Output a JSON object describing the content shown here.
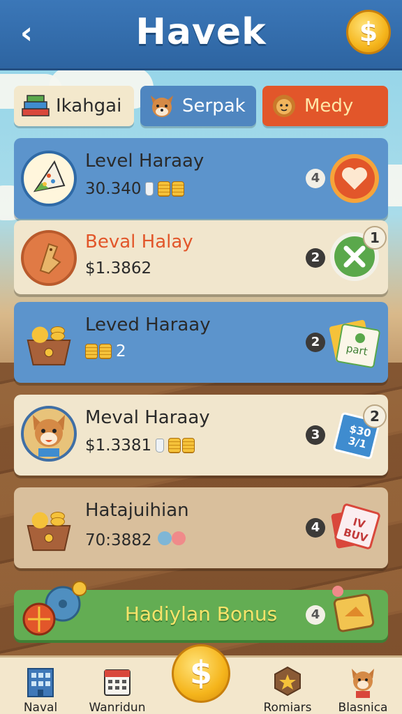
{
  "header": {
    "title": "Havek",
    "back_icon": "chevron-left-icon",
    "coin_icon": "dollar-coin-icon"
  },
  "tabs": [
    {
      "label": "Ikahgai",
      "icon": "books-icon"
    },
    {
      "label": "Serpak",
      "icon": "fox-face-icon"
    },
    {
      "label": "Medy",
      "icon": "lion-face-icon"
    }
  ],
  "cards": [
    {
      "name": "Level Haraay",
      "value": "30.340",
      "count": "4",
      "action": "heart-icon",
      "corner": ""
    },
    {
      "name": "Beval Halay",
      "value": "$1.3862",
      "count": "2",
      "action": "close-icon",
      "corner": "1"
    },
    {
      "name": "Leved Haraay",
      "value": "2",
      "count": "2",
      "action": "card-icon",
      "action_text": "part",
      "corner": ""
    },
    {
      "name": "Meval Haraay",
      "value": "$1.3381",
      "count": "3",
      "action": "card-icon",
      "action_text": "$30 3/1",
      "corner": "2"
    },
    {
      "name": "Hatajuihian",
      "value": "70:3882",
      "count": "4",
      "action": "card-icon",
      "action_text": "IV BUV",
      "corner": ""
    }
  ],
  "bonus": {
    "label": "Hadiylan Bonus",
    "count": "4"
  },
  "bottom_nav": [
    {
      "label": "Naval",
      "icon": "building-icon"
    },
    {
      "label": "Wanridun",
      "icon": "calendar-icon"
    },
    {
      "label": "",
      "icon": "dollar-coin-icon"
    },
    {
      "label": "Romiars",
      "icon": "badge-icon"
    },
    {
      "label": "Blasnica",
      "icon": "fox-character-icon"
    }
  ],
  "colors": {
    "header": "#2d64a1",
    "blue_card": "#5c94cc",
    "cream_card": "#f1e6cd",
    "bonus": "#63ad53",
    "accent": "#e2562a"
  }
}
